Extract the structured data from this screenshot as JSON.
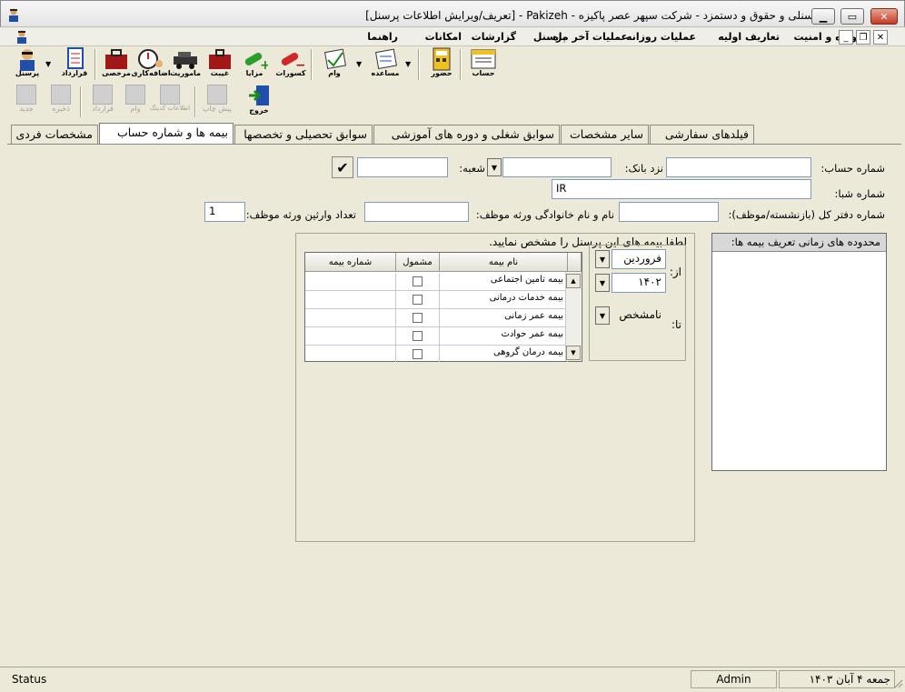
{
  "window": {
    "title": "پرسنلی و حقوق و دستمزد - شرکت سپهر عصر پاکیزه - Pakizeh - [تعریف/ویرایش اطلاعات پرسنل]"
  },
  "menu": [
    "پرونده و امنیت",
    "تعاریف اولیه",
    "عملیات روزانه",
    "عملیات آخر ماه",
    "پرسنل",
    "گزارشات",
    "امکانات",
    "راهنما"
  ],
  "toolbar": {
    "personnel": "پرسنل",
    "contract": "قرارداد",
    "leave": "مرخصی",
    "overtime": "اضافه‌کاری",
    "mission": "ماموریت",
    "absence": "غیبت",
    "benefits": "مزایا",
    "deductions": "کسورات",
    "loan": "وام",
    "assistance": "مساعده",
    "attendance": "حضور",
    "account": "حساب"
  },
  "toolbar2": {
    "new": "جدید",
    "save": "ذخیره",
    "contract": "قرارداد",
    "loan": "وام",
    "info": "اطلاعات کدینگ",
    "preview": "پیش چاپ",
    "exit": "خروج"
  },
  "tabs": [
    "مشخصات فردی",
    "بیمه ها و شماره حساب",
    "سوابق تحصیلی و تخصصها",
    "سوابق شغلی و دوره های آموزشی",
    "سایر مشخصات",
    "فیلدهای سفارشی"
  ],
  "form": {
    "account_number_label": "شماره حساب:",
    "bank_label": "نزد بانک:",
    "branch_label": "شعبه:",
    "sheba_label": "شماره شبا:",
    "sheba_value": "IR",
    "ledger_label": "شماره دفتر کل (بازنشسته/موظف):",
    "heir_name_label": "نام و نام خانوادگی ورثه موظف:",
    "heirs_count_label": "تعداد وارثین ورثه موظف:",
    "heirs_count_value": "1"
  },
  "insurance": {
    "prompt": "لطفا بیمه های این پرسنل را مشخص نمایید.",
    "columns": [
      "نام بیمه",
      "مشمول",
      "شماره بیمه"
    ],
    "rows": [
      {
        "name": "بیمه تامین اجتماعی",
        "included": false,
        "number": ""
      },
      {
        "name": "بیمه خدمات درمانی",
        "included": false,
        "number": ""
      },
      {
        "name": "بیمه عمر زمانی",
        "included": false,
        "number": ""
      },
      {
        "name": "بیمه عمر حوادث",
        "included": false,
        "number": ""
      },
      {
        "name": "بیمه درمان گروهی",
        "included": false,
        "number": ""
      }
    ]
  },
  "date_range": {
    "from_label": "از:",
    "to_label": "تا:",
    "from_month": "فروردین",
    "from_year": "۱۴۰۲",
    "to_value": "نامشخص"
  },
  "range_panel": {
    "title": "محدوده های زمانی تعریف بیمه ها:"
  },
  "status": {
    "text": "Status",
    "user": "Admin",
    "date": "جمعه ۴ آبان ۱۴۰۳"
  }
}
